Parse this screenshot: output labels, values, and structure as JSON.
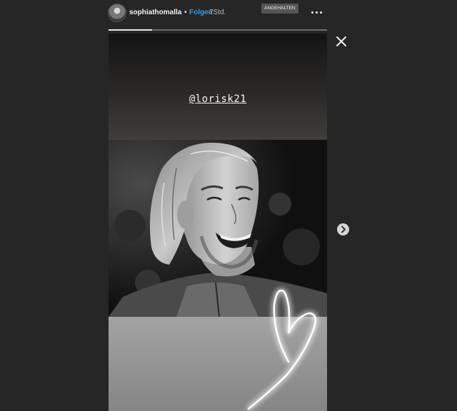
{
  "header": {
    "username": "sophiathomalla",
    "separator": "•",
    "follow_label": "Folgen",
    "time_ago": "7Std.",
    "paused_badge": "ANGEHALTEN"
  },
  "story": {
    "mention": "@lorisk21",
    "progress": 0.2
  },
  "icons": {
    "more": "more-options-icon",
    "close": "close-icon",
    "next": "chevron-right-icon"
  },
  "colors": {
    "background": "#262626",
    "follow": "#3897f0",
    "progress_track": "#6c6c6c",
    "progress_fill": "#e8e8e8"
  }
}
